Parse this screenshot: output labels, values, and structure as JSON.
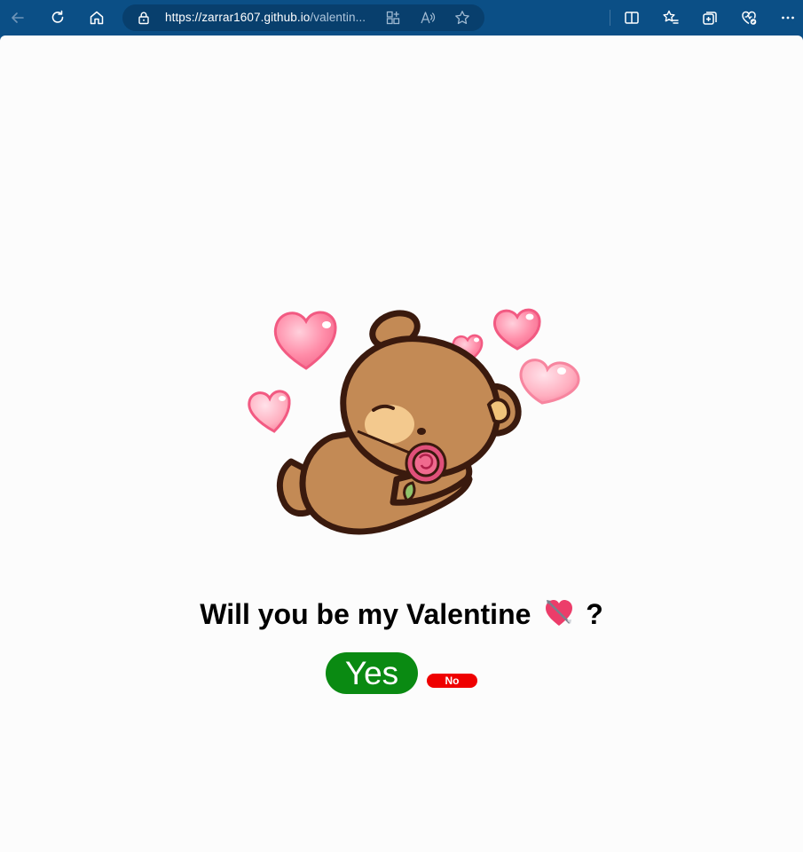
{
  "browser": {
    "url_host": "https://zarrar1607.github.io",
    "url_path": "/valentin..."
  },
  "page": {
    "question": "Will you be my Valentine",
    "question_emoji": "heart-with-arrow",
    "question_mark": "?",
    "yes_label": "Yes",
    "no_label": "No"
  },
  "colors": {
    "yes_button": "#0a8a12",
    "no_button": "#ef0000",
    "chrome": "#0b4f86"
  },
  "icons": [
    "back-icon",
    "refresh-icon",
    "home-icon",
    "lock-icon",
    "app-available-icon",
    "read-aloud-icon",
    "favorite-star-icon",
    "split-screen-icon",
    "favorites-icon",
    "collections-icon",
    "browser-essentials-icon",
    "more-options-icon"
  ]
}
